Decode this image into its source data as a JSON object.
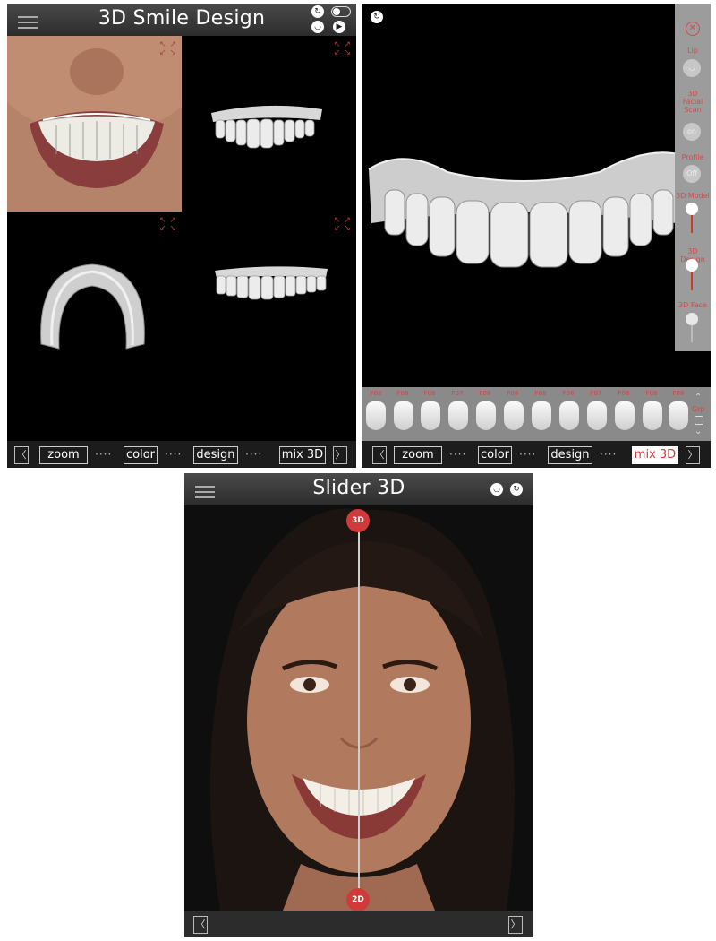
{
  "panel1": {
    "title": "3D Smile Design",
    "bottom": {
      "prev": "〈",
      "zoom": "zoom",
      "color": "color",
      "design": "design",
      "mix3d": "mix 3D",
      "next": "〉",
      "dots": "····"
    }
  },
  "panel2": {
    "bottom": {
      "prev": "〈",
      "zoom": "zoom",
      "color": "color",
      "design": "design",
      "mix3d": "mix 3D",
      "next": "〉",
      "dots": "····",
      "active": "mix 3D"
    },
    "side": {
      "lip": "Lip",
      "facial_scan": "3D Facial Scan",
      "facial_scan_state": "on",
      "profile": "Profile",
      "profile_state": "Off",
      "model": "3D Model",
      "design": "3D Design",
      "face": "3D Face"
    },
    "library": {
      "labels": [
        "F08",
        "F08",
        "F08",
        "F07",
        "F08",
        "F08",
        "F08",
        "F08",
        "F07",
        "F08",
        "F08",
        "F08"
      ],
      "grp": "Grp"
    }
  },
  "panel3": {
    "title": "Slider 3D",
    "top_marker": "3D",
    "bottom_marker": "2D",
    "prev": "〈",
    "next": "〉"
  },
  "colors": {
    "accent": "#d03a3a",
    "bar": "#2c2c2c"
  }
}
